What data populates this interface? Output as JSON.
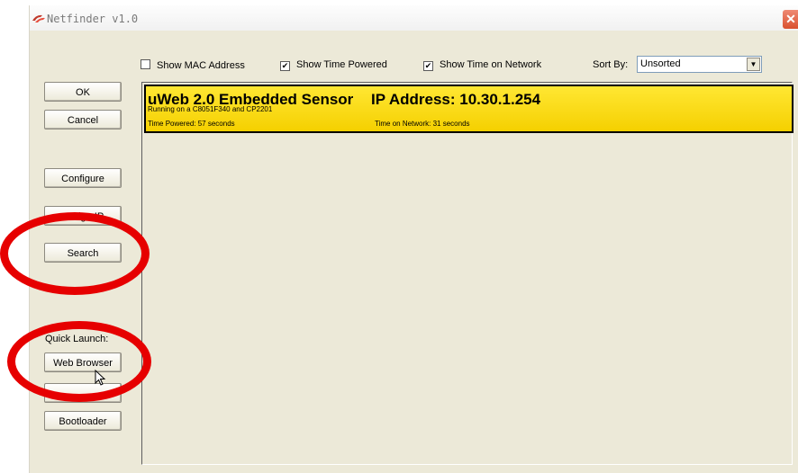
{
  "window": {
    "title": "Netfinder v1.0",
    "close_icon": "close-icon"
  },
  "buttons": {
    "ok": "OK",
    "cancel": "Cancel",
    "configure": "Configure",
    "assign_ip": "Assign IP",
    "search": "Search",
    "quick_launch_label": "Quick Launch:",
    "web_browser": "Web Browser",
    "hidden": "",
    "bootloader": "Bootloader"
  },
  "options": {
    "show_mac": {
      "label": "Show MAC Address",
      "checked": false
    },
    "show_time_powered": {
      "label": "Show Time Powered",
      "checked": true
    },
    "show_time_network": {
      "label": "Show Time on Network",
      "checked": true
    }
  },
  "sort": {
    "label": "Sort By:",
    "value": "Unsorted"
  },
  "devices": [
    {
      "name": "uWeb 2.0 Embedded Sensor",
      "ip": "IP Address: 10.30.1.254",
      "subtitle": "Running on a C8051F340 and CP2201",
      "time_powered": "Time Powered:  57 seconds",
      "time_network": "Time on Network:  31 seconds"
    }
  ],
  "colors": {
    "highlight_ring": "#e60000",
    "device_card": "#f5d000"
  }
}
